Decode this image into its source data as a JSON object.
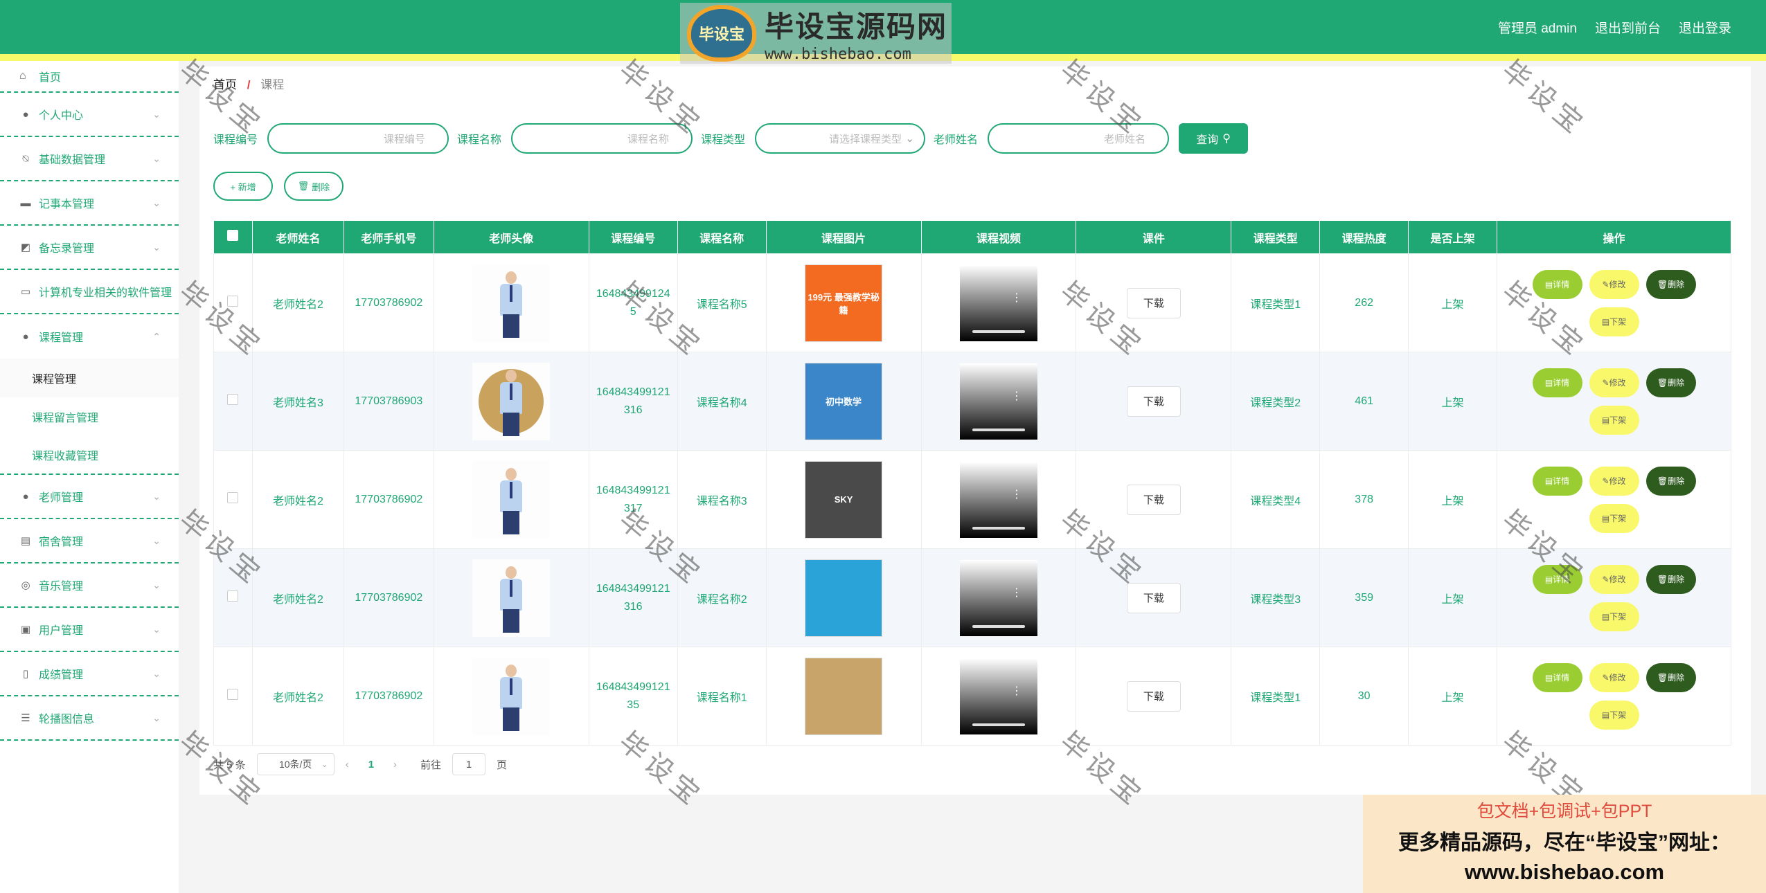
{
  "header": {
    "logo_badge": "毕设宝",
    "logo_title": "毕设宝源码网",
    "logo_url": "www.bishebao.com",
    "nav": [
      "管理员 admin",
      "退出到前台",
      "退出登录"
    ]
  },
  "sidebar": {
    "home": "首页",
    "items": [
      {
        "label": "个人中心",
        "icon": "user-icon"
      },
      {
        "label": "基础数据管理",
        "icon": "bell-off-icon"
      },
      {
        "label": "记事本管理",
        "icon": "monitor-icon"
      },
      {
        "label": "备忘录管理",
        "icon": "chart-icon"
      },
      {
        "label": "计算机专业相关的软件管理",
        "icon": "chat-icon"
      },
      {
        "label": "课程管理",
        "icon": "user-icon"
      }
    ],
    "sub_items": [
      "课程管理",
      "课程留言管理",
      "课程收藏管理"
    ],
    "items_after": [
      {
        "label": "老师管理",
        "icon": "user-icon"
      },
      {
        "label": "宿舍管理",
        "icon": "building-icon"
      },
      {
        "label": "音乐管理",
        "icon": "compass-icon"
      },
      {
        "label": "用户管理",
        "icon": "clipboard-icon"
      },
      {
        "label": "成绩管理",
        "icon": "mic-icon"
      },
      {
        "label": "轮播图信息",
        "icon": "sliders-icon"
      }
    ]
  },
  "breadcrumb": {
    "home": "首页",
    "sep": "/",
    "current": "课程"
  },
  "filters": {
    "course_no_label": "课程编号",
    "course_no_placeholder": "课程编号",
    "course_name_label": "课程名称",
    "course_name_placeholder": "课程名称",
    "course_type_label": "课程类型",
    "course_type_placeholder": "请选择课程类型",
    "teacher_label": "老师姓名",
    "teacher_placeholder": "老师姓名",
    "query_label": "查询"
  },
  "actions": {
    "add": "+ 新增",
    "delete": "删除"
  },
  "table": {
    "headers": [
      "老师姓名",
      "老师手机号",
      "老师头像",
      "课程编号",
      "课程名称",
      "课程图片",
      "课程视频",
      "课件",
      "课程类型",
      "课程热度",
      "是否上架",
      "操作"
    ],
    "rows": [
      {
        "teacher": "老师姓名2",
        "phone": "17703786902",
        "no": "1648434991245",
        "name": "课程名称5",
        "download": "下载",
        "type": "课程类型1",
        "heat": "262",
        "status": "上架"
      },
      {
        "teacher": "老师姓名3",
        "phone": "17703786903",
        "no": "164843499121316",
        "name": "课程名称4",
        "download": "下载",
        "type": "课程类型2",
        "heat": "461",
        "status": "上架"
      },
      {
        "teacher": "老师姓名2",
        "phone": "17703786902",
        "no": "164843499121317",
        "name": "课程名称3",
        "download": "下载",
        "type": "课程类型4",
        "heat": "378",
        "status": "上架"
      },
      {
        "teacher": "老师姓名2",
        "phone": "17703786902",
        "no": "164843499121316",
        "name": "课程名称2",
        "download": "下载",
        "type": "课程类型3",
        "heat": "359",
        "status": "上架"
      },
      {
        "teacher": "老师姓名2",
        "phone": "17703786902",
        "no": "16484349912135",
        "name": "课程名称1",
        "download": "下载",
        "type": "课程类型1",
        "heat": "30",
        "status": "上架"
      }
    ],
    "course_img_text": [
      "199元 最强教学秘籍",
      "初中数学",
      "SKY",
      "",
      ""
    ],
    "ops": {
      "detail": "详情",
      "edit": "修改",
      "delete": "删除",
      "offline": "下架"
    }
  },
  "pager": {
    "total": "共 5 条",
    "size": "10条/页",
    "current": "1",
    "goto": "前往",
    "goto_value": "1",
    "page_unit": "页"
  },
  "watermark": "毕设宝",
  "ad": {
    "line1": "包文档+包调试+包PPT",
    "line2": "更多精品源码，尽在“毕设宝”网址：",
    "line3": "www.bishebao.com"
  },
  "colors": {
    "primary": "#1fa774",
    "accent": "#f5f96a",
    "danger": "#2e5b1e"
  }
}
